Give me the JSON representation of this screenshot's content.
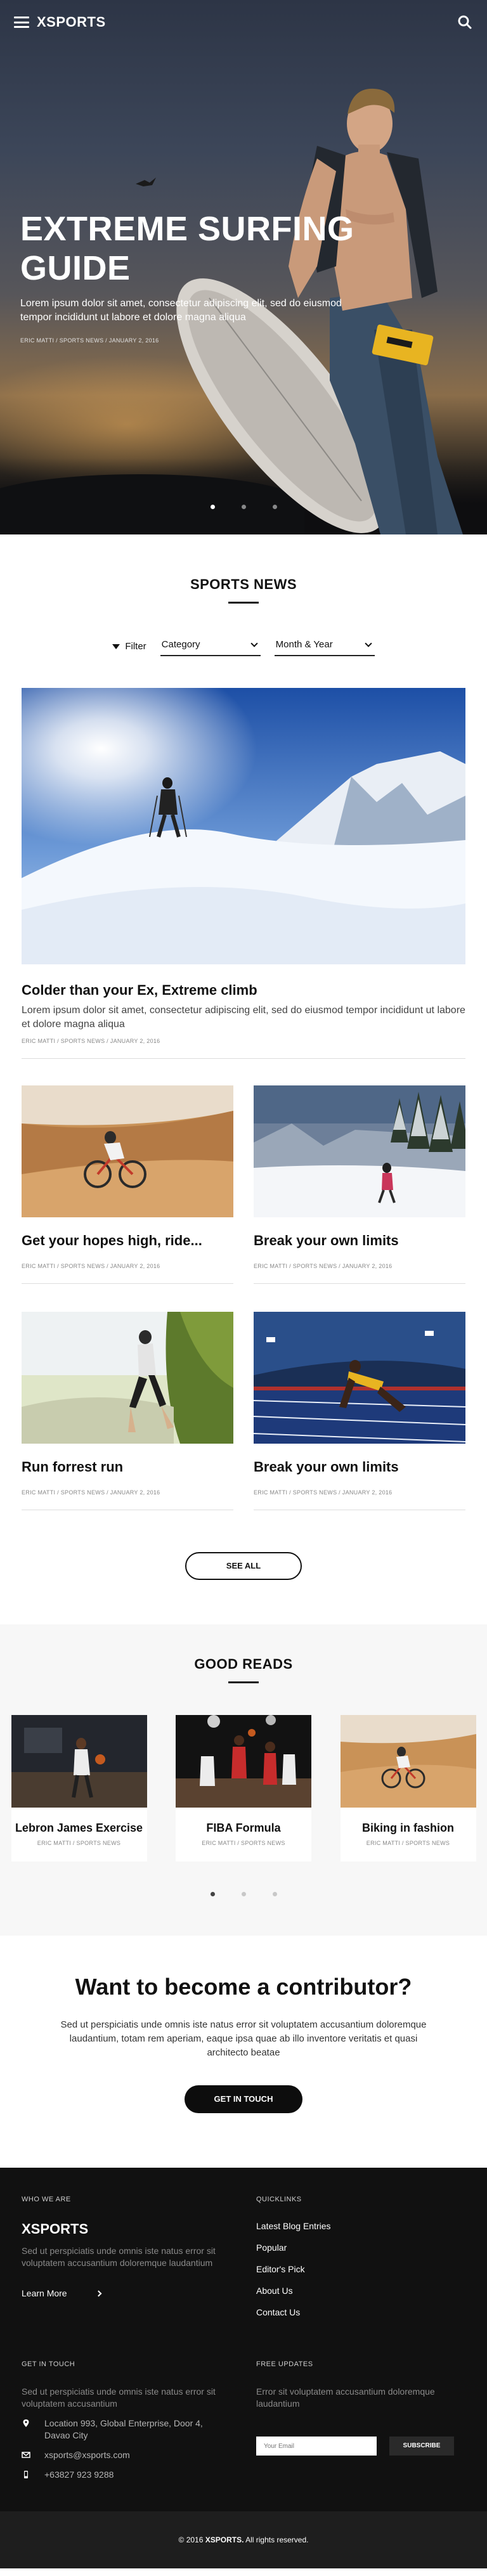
{
  "brand": {
    "logo": "XSPORTS"
  },
  "hero": {
    "title": "EXTREME SURFING GUIDE",
    "description": "Lorem ipsum dolor sit amet, consectetur adipiscing elit, sed do eiusmod tempor incididunt ut labore et dolore magna aliqua",
    "meta": "ERIC MATTI / SPORTS NEWS / JANUARY 2, 2016",
    "slides": 3,
    "active_slide": 1
  },
  "news": {
    "title": "SPORTS NEWS",
    "filter_label": "Filter",
    "category_select": "Category",
    "date_select": "Month & Year",
    "feature": {
      "title": "Colder than your Ex, Extreme climb",
      "excerpt": "Lorem ipsum dolor sit amet, consectetur adipiscing elit, sed do eiusmod tempor incididunt ut labore et dolore magna aliqua",
      "meta": "ERIC MATTI / SPORTS NEWS / JANUARY 2, 2016"
    },
    "posts": [
      {
        "title": "Get your hopes high, ride...",
        "meta": "ERIC MATTI / SPORTS NEWS / JANUARY 2, 2016",
        "image": "mountain-bike"
      },
      {
        "title": "Break your own limits",
        "meta": "ERIC MATTI / SPORTS NEWS / JANUARY 2, 2016",
        "image": "ski-slope"
      },
      {
        "title": "Run forrest run",
        "meta": "ERIC MATTI / SPORTS NEWS / JANUARY 2, 2016",
        "image": "runner"
      },
      {
        "title": "Break your own limits",
        "meta": "ERIC MATTI / SPORTS NEWS / JANUARY 2, 2016",
        "image": "sprinter"
      }
    ],
    "see_all": "SEE ALL"
  },
  "reads": {
    "title": "GOOD READS",
    "items": [
      {
        "title": "Lebron James Exercise",
        "meta": "ERIC MATTI / SPORTS NEWS"
      },
      {
        "title": "FIBA Formula",
        "meta": "ERIC MATTI / SPORTS NEWS"
      },
      {
        "title": "Biking in fashion",
        "meta": "ERIC MATTI / SPORTS NEWS"
      }
    ]
  },
  "contributor": {
    "title": "Want to become a contributor?",
    "text": "Sed ut perspiciatis unde omnis iste natus error sit voluptatem accusantium doloremque laudantium, totam rem aperiam, eaque ipsa quae ab illo inventore veritatis et quasi architecto beatae",
    "button": "GET IN TOUCH"
  },
  "footer": {
    "who_head": "WHO WE ARE",
    "who_logo": "XSPORTS",
    "who_text": "Sed ut perspiciatis unde omnis iste natus error sit voluptatem accusantium doloremque laudantium",
    "learn_more": "Learn More",
    "quick_head": "QUICKLINKS",
    "quick_links": [
      "Latest Blog Entries",
      "Popular",
      "Editor's Pick",
      "About Us",
      "Contact Us"
    ],
    "touch_head": "GET IN TOUCH",
    "touch_text": "Sed ut perspiciatis unde omnis iste natus error sit voluptatem accusantium",
    "address": "Location 993, Global Enterprise, Door 4, Davao City",
    "email": "xsports@xsports.com",
    "phone": "+63827 923 9288",
    "updates_head": "FREE UPDATES",
    "updates_text": "Error sit voluptatem accusantium doloremque laudantium",
    "email_placeholder": "Your Email",
    "subscribe": "SUBSCRIBE",
    "copyright_pre": "© 2016",
    "copyright_brand": "XSPORTS.",
    "copyright_post": "All rights reserved."
  },
  "colors": {
    "dark": "#111111",
    "footer_bottom": "#1e1e1e",
    "reads_bg": "#f7f7f7",
    "accent_yellow": "#e8b421"
  }
}
